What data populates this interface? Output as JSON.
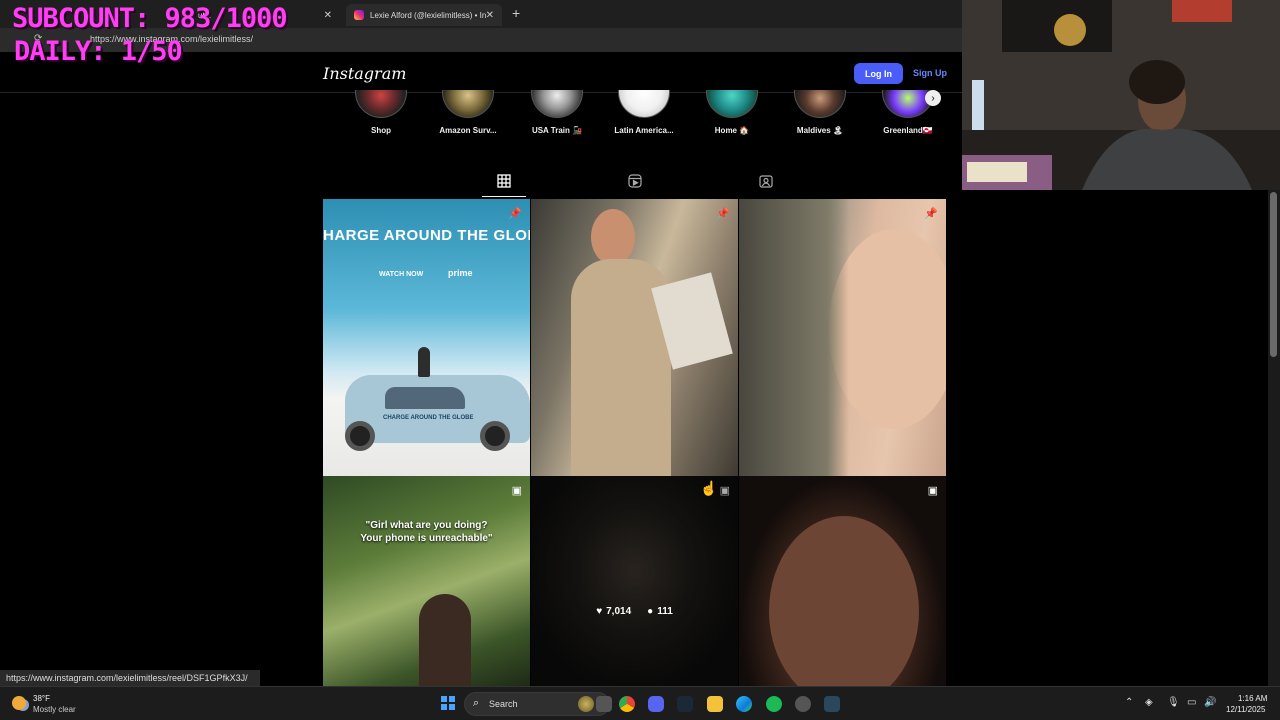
{
  "overlay": {
    "subcount": "SUBCOUNT: 983/1000",
    "daily": "DAILY: 1/50"
  },
  "browser": {
    "tabs": [
      {
        "label": "ube",
        "close": "✕"
      },
      {
        "label": "Lexie Alford (@lexielimitless) • Inst",
        "close": "✕"
      }
    ],
    "new_tab": "+",
    "url": "https://www.instagram.com/lexielimitless/"
  },
  "instagram": {
    "logo": "Instagram",
    "login_label": "Log In",
    "signup_label": "Sign Up",
    "highlights": [
      "Shop",
      "Amazon Surv...",
      "USA Train 🚂",
      "Latin America...",
      "Home 🏠",
      "Maldives 🏝",
      "Greenland🇬🇱"
    ],
    "highlights_next": "›",
    "post_stats": {
      "likes": "7,014",
      "comments": "111"
    },
    "post1_title": "HARGE AROUND THE GLOB",
    "post1_watch": "WATCH NOW",
    "post1_prime": "prime",
    "post1_car_text": "CHARGE AROUND THE GLOBE",
    "post4_caption_1": "\"Girl what are you doing?",
    "post4_caption_2": "Your phone is unreachable\""
  },
  "status_url": "https://www.instagram.com/lexielimitless/reel/DSF1GPfkX3J/",
  "taskbar": {
    "temp": "38°F",
    "condition": "Mostly clear",
    "search_label": "Search",
    "time": "1:16 AM",
    "date": "12/11/2025"
  },
  "colors": {
    "login_button": "#4a5df9",
    "overlay_text": "#ff3df2",
    "signup_text": "#6d85ff"
  }
}
